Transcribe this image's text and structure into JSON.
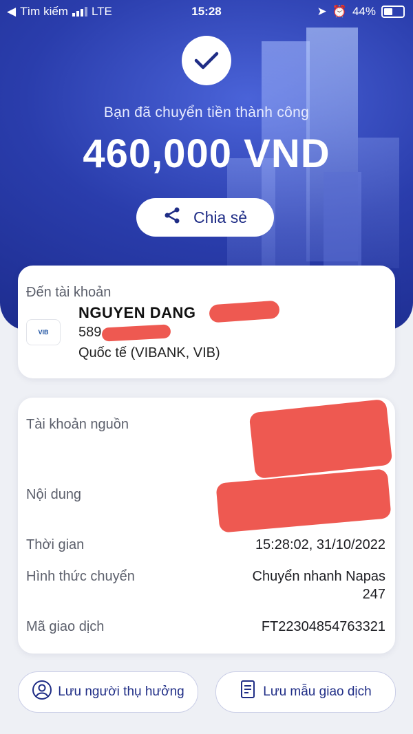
{
  "status_bar": {
    "back_label": "Tìm kiếm",
    "carrier": "LTE",
    "time": "15:28",
    "battery": "44%"
  },
  "header": {
    "success_message": "Bạn đã chuyển tiền thành công",
    "amount": "460,000 VND",
    "share_label": "Chia sẻ"
  },
  "recipient": {
    "label": "Đến tài khoản",
    "name": "NGUYEN DANG",
    "account_prefix": "589",
    "bank": "Quốc tế (VIBANK, VIB)",
    "logo_text": "VIB"
  },
  "details": {
    "source_label": "Tài khoản nguồn",
    "content_label": "Nội dung",
    "time_label": "Thời gian",
    "time_value": "15:28:02, 31/10/2022",
    "method_label": "Hình thức chuyển",
    "method_value_line1": "Chuyển nhanh Napas",
    "method_value_line2": "247",
    "tx_label": "Mã giao dịch",
    "tx_value": "FT22304854763321"
  },
  "actions": {
    "save_beneficiary": "Lưu người thụ hưởng",
    "save_template": "Lưu mẫu giao dịch"
  },
  "colors": {
    "brand_blue": "#1f2d86",
    "hero_blue": "#2a3dac",
    "redaction": "#eb3c32"
  },
  "icons": [
    "back-arrow-icon",
    "signal-icon",
    "location-icon",
    "alarm-icon",
    "battery-icon",
    "check-icon",
    "share-icon",
    "vib-logo",
    "user-icon",
    "document-icon"
  ]
}
